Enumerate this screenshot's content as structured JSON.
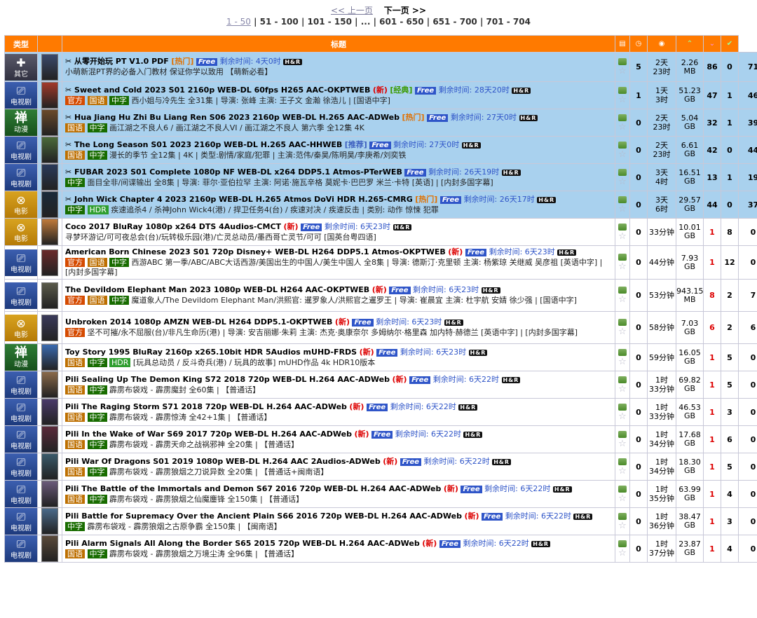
{
  "pager": {
    "prev": "<< 上一页",
    "next": "下一页 >>",
    "pages": [
      "1 - 50",
      "51 - 100",
      "101 - 150",
      "...",
      "601 - 650",
      "651 - 700",
      "701 - 704"
    ]
  },
  "header": {
    "category": "类型",
    "title": "标题",
    "comments_icon": "comments-icon",
    "time_icon": "clock-icon",
    "size_icon": "size-icon",
    "seeders_icon": "seeders-icon",
    "leechers_icon": "leechers-icon",
    "completed_icon": "completed-icon"
  },
  "rows": [
    {
      "cat": "其它",
      "catIcon": "other",
      "top": true,
      "title": "从零开始玩 PT V1.0 PDF",
      "badge": "hot",
      "badge_text": "[热门]",
      "free": "Free",
      "remain": "剩余时间: 4天0时",
      "tags": [],
      "sub": "小萌新混PT界的必备入门教材 保证你学以致用 【萌新必看】",
      "comments": "5",
      "t1": "2天",
      "t2": "23时",
      "s1": "2.26",
      "s2": "MB",
      "seed": "86",
      "leech": "0",
      "done": "71"
    },
    {
      "cat": "电视剧",
      "catIcon": "tv",
      "top": true,
      "title": "Sweet and Cold 2023 S01 2160p WEB-DL 60fps H265 AAC-OKPTWEB",
      "badge": "new",
      "badge_text": "(新)",
      "badge2": "[经典]",
      "free": "Free",
      "remain": "剩余时间: 28天20时",
      "tags": [
        "官方",
        "国语",
        "中字"
      ],
      "sub": "西小姐与冷先生 全31集 | 导演: 张峰 主演: 王子文 金瀚 徐浩儿 | [国语中字]",
      "comments": "1",
      "t1": "1天",
      "t2": "3时",
      "s1": "51.23",
      "s2": "GB",
      "seed": "47",
      "leech": "1",
      "done": "46"
    },
    {
      "cat": "动漫",
      "catIcon": "anime",
      "top": true,
      "title": "Hua Jiang Hu Zhi Bu Liang Ren S06 2023 2160p WEB-DL H.265 AAC-ADWeb",
      "badge": "hot",
      "badge_text": "[热门]",
      "free": "Free",
      "remain": "剩余时间: 27天0时",
      "tags": [
        "国语",
        "中字"
      ],
      "sub": "画江湖之不良人6 / 画江湖之不良人VI / 画江湖之不良人 第六季 全12集 4K",
      "comments": "0",
      "t1": "2天",
      "t2": "23时",
      "s1": "5.04",
      "s2": "GB",
      "seed": "32",
      "leech": "1",
      "done": "39"
    },
    {
      "cat": "电视剧",
      "catIcon": "tv",
      "top": true,
      "title": "The Long Season S01 2023 2160p WEB-DL H.265 AAC-HHWEB",
      "badge": "rec",
      "badge_text": "[推荐]",
      "free": "Free",
      "remain": "剩余时间: 27天0时",
      "tags": [
        "国语",
        "中字"
      ],
      "sub": "漫长的季节 全12集 | 4K | 类型:剧情/家庭/犯罪 | 主演:范伟/秦昊/陈明昊/李庚希/刘奕铁",
      "comments": "0",
      "t1": "2天",
      "t2": "23时",
      "s1": "6.61",
      "s2": "GB",
      "seed": "42",
      "leech": "0",
      "done": "44"
    },
    {
      "cat": "电视剧",
      "catIcon": "tv",
      "top": true,
      "title": "FUBAR 2023 S01 Complete 1080p NF WEB-DL x264 DDP5.1 Atmos-PTerWEB",
      "badge": "",
      "badge_text": "",
      "free": "Free",
      "remain": "剩余时间: 26天19时",
      "tags": [
        "中字"
      ],
      "sub": "面目全非/间谍输出 全8集 | 导演: 菲尔·亚伯拉罕 主演: 阿诺·施瓦辛格 莫妮卡·巴巴罗 米兰·卡特 [英语] | [内封多国字幕]",
      "comments": "0",
      "t1": "3天",
      "t2": "4时",
      "s1": "16.51",
      "s2": "GB",
      "seed": "13",
      "leech": "1",
      "done": "19"
    },
    {
      "cat": "电影",
      "catIcon": "movie",
      "top": true,
      "title": "John Wick Chapter 4 2023 2160p WEB-DL H.265 Atmos DoVi HDR H.265-CMRG",
      "badge": "hot",
      "badge_text": "[热门]",
      "free": "Free",
      "remain": "剩余时间: 26天17时",
      "tags": [
        "中字",
        "HDR"
      ],
      "sub": "疾速追杀4 / 杀神John Wick4(港) / 捍卫任务4(台) / 疾速对决 / 疾速反击 | 类别: 动作 惊悚 犯罪",
      "comments": "0",
      "t1": "3天",
      "t2": "6时",
      "s1": "29.57",
      "s2": "GB",
      "seed": "44",
      "leech": "0",
      "done": "37"
    },
    {
      "cat": "电影",
      "catIcon": "movie",
      "top": false,
      "title": "Coco 2017 BluRay 1080p x264 DTS 4Audios-CMCT",
      "badge": "new",
      "badge_text": "(新)",
      "free": "Free",
      "remain": "剩余时间: 6天23时",
      "tags": [],
      "sub": "寻梦环游记/可可夜总会(台)/玩转极乐园(港)/亡灵总动员/墨西哥亡灵节/可可 [国英台粤四语]",
      "comments": "0",
      "t1": "33分钟",
      "t2": "",
      "s1": "10.01",
      "s2": "GB",
      "seed": "1",
      "leech": "8",
      "done": "0"
    },
    {
      "cat": "电视剧",
      "catIcon": "tv",
      "top": false,
      "title": "American Born Chinese 2023 S01 720p Disney+ WEB-DL H264 DDP5.1 Atmos-OKPTWEB",
      "badge": "new",
      "badge_text": "(新)",
      "free": "Free",
      "remain": "剩余时间: 6天23时",
      "tags": [
        "官方",
        "国语",
        "中字"
      ],
      "sub": "西游ABC 第一季/ABC/ABC大话西游/美国出生的中国人/美生中国人 全8集 | 导演: 德斯汀·克里顿 主演: 杨紫琼 关继威 吴彦祖 [英语中字] | [内封多国字幕]",
      "comments": "0",
      "t1": "44分钟",
      "t2": "",
      "s1": "7.93",
      "s2": "GB",
      "seed": "1",
      "leech": "12",
      "done": "0"
    },
    {
      "cat": "电视剧",
      "catIcon": "tv",
      "top": false,
      "title": "The Devildom Elephant Man 2023 1080p WEB-DL H264 AAC-OKPTWEB",
      "badge": "new",
      "badge_text": "(新)",
      "free": "Free",
      "remain": "剩余时间: 6天23时",
      "tags": [
        "官方",
        "国语",
        "中字"
      ],
      "sub": "魔道象人/The Devildom Elephant Man/洪熙官: 暹罗象人/洪熙官之暹罗王 | 导演: 崔晨宜 主演: 杜宇航 安婧 徐少强 | [国语中字]",
      "comments": "0",
      "t1": "53分钟",
      "t2": "",
      "s1": "943.15",
      "s2": "MB",
      "seed": "8",
      "leech": "2",
      "done": "7"
    },
    {
      "cat": "电影",
      "catIcon": "movie",
      "top": false,
      "title": "Unbroken 2014 1080p AMZN WEB-DL H264 DDP5.1-OKPTWEB",
      "badge": "new",
      "badge_text": "(新)",
      "free": "Free",
      "remain": "剩余时间: 6天23时",
      "tags": [
        "官方"
      ],
      "sub": "坚不可摧/永不屈服(台)/非凡生命历(港) | 导演: 安吉丽娜·朱莉 主演: 杰克·奥康奈尔 多姆纳尔·格里森 加内特·赫德兰 [英语中字] | [内封多国字幕]",
      "comments": "0",
      "t1": "58分钟",
      "t2": "",
      "s1": "7.03",
      "s2": "GB",
      "seed": "6",
      "leech": "2",
      "done": "6"
    },
    {
      "cat": "动漫",
      "catIcon": "anime",
      "top": false,
      "title": "Toy Story 1995 BluRay 2160p x265.10bit HDR 5Audios mUHD-FRDS",
      "badge": "new",
      "badge_text": "(新)",
      "free": "Free",
      "remain": "剩余时间: 6天23时",
      "tags": [
        "国语",
        "中字",
        "HDR"
      ],
      "sub": "[玩具总动员 / 反斗奇兵(港) / 玩具的故事] mUHD作品 4k HDR10版本",
      "comments": "0",
      "t1": "59分钟",
      "t2": "",
      "s1": "16.05",
      "s2": "GB",
      "seed": "1",
      "leech": "5",
      "done": "0"
    },
    {
      "cat": "电视剧",
      "catIcon": "tv",
      "top": false,
      "title": "Pili Sealing Up The Demon King S72 2018 720p WEB-DL H.264 AAC-ADWeb",
      "badge": "new",
      "badge_text": "(新)",
      "free": "Free",
      "remain": "剩余时间: 6天22时",
      "tags": [
        "国语",
        "中字"
      ],
      "sub": "霹雳布袋戏 - 霹雳魔封 全60集 | 【普通话】",
      "comments": "0",
      "t1": "1时",
      "t2": "33分钟",
      "s1": "69.82",
      "s2": "GB",
      "seed": "1",
      "leech": "5",
      "done": "0"
    },
    {
      "cat": "电视剧",
      "catIcon": "tv",
      "top": false,
      "title": "Pili The Raging Storm S71 2018 720p WEB-DL H.264 AAC-ADWeb",
      "badge": "new",
      "badge_text": "(新)",
      "free": "Free",
      "remain": "剩余时间: 6天22时",
      "tags": [
        "国语",
        "中字"
      ],
      "sub": "霹雳布袋戏 - 霹雳惊涛 全42+1集 | 【普通话】",
      "comments": "0",
      "t1": "1时",
      "t2": "33分钟",
      "s1": "46.53",
      "s2": "GB",
      "seed": "1",
      "leech": "3",
      "done": "0"
    },
    {
      "cat": "电视剧",
      "catIcon": "tv",
      "top": false,
      "title": "Pili In the Wake of War S69 2017 720p WEB-DL H.264 AAC-ADWeb",
      "badge": "new",
      "badge_text": "(新)",
      "free": "Free",
      "remain": "剩余时间: 6天22时",
      "tags": [
        "国语",
        "中字"
      ],
      "sub": "霹雳布袋戏 - 霹雳天命之战祸邪神 全20集 | 【普通话】",
      "comments": "0",
      "t1": "1时",
      "t2": "34分钟",
      "s1": "17.68",
      "s2": "GB",
      "seed": "1",
      "leech": "6",
      "done": "0"
    },
    {
      "cat": "电视剧",
      "catIcon": "tv",
      "top": false,
      "title": "Pili War Of Dragons S01 2019 1080p WEB-DL H.264 AAC 2Audios-ADWeb",
      "badge": "new",
      "badge_text": "(新)",
      "free": "Free",
      "remain": "剩余时间: 6天22时",
      "tags": [
        "国语",
        "中字"
      ],
      "sub": "霹雳布袋戏 - 霹雳狼烟之刀说异数 全20集 | 【普通话+闽南语】",
      "comments": "0",
      "t1": "1时",
      "t2": "34分钟",
      "s1": "18.30",
      "s2": "GB",
      "seed": "1",
      "leech": "5",
      "done": "0"
    },
    {
      "cat": "电视剧",
      "catIcon": "tv",
      "top": false,
      "title": "Pili The Battle of the Immortals and Demon S67 2016 720p WEB-DL H.264 AAC-ADWeb",
      "badge": "new",
      "badge_text": "(新)",
      "free": "Free",
      "remain": "剩余时间: 6天22时",
      "tags": [
        "国语",
        "中字"
      ],
      "sub": "霹雳布袋戏 - 霹雳狼烟之仙魔鏖锋 全150集 | 【普通话】",
      "comments": "0",
      "t1": "1时",
      "t2": "35分钟",
      "s1": "63.99",
      "s2": "GB",
      "seed": "1",
      "leech": "4",
      "done": "0"
    },
    {
      "cat": "电视剧",
      "catIcon": "tv",
      "top": false,
      "title": "Pili Battle for Supremacy Over the Ancient Plain S66 2016 720p WEB-DL H.264 AAC-ADWeb",
      "badge": "new",
      "badge_text": "(新)",
      "free": "Free",
      "remain": "剩余时间: 6天22时",
      "tags": [
        "中字"
      ],
      "sub": "霹雳布袋戏 - 霹雳狼烟之古原争霸 全150集 | 【闽南语】",
      "comments": "0",
      "t1": "1时",
      "t2": "36分钟",
      "s1": "38.47",
      "s2": "GB",
      "seed": "1",
      "leech": "3",
      "done": "0"
    },
    {
      "cat": "电视剧",
      "catIcon": "tv",
      "top": false,
      "title": "Pili Alarm Signals All Along the Border S65 2015 720p WEB-DL H.264 AAC-ADWeb",
      "badge": "new",
      "badge_text": "(新)",
      "free": "Free",
      "remain": "剩余时间: 6天22时",
      "tags": [
        "国语",
        "中字"
      ],
      "sub": "霹雳布袋戏 - 霹雳狼烟之万境尘涛 全96集 | 【普通话】",
      "comments": "0",
      "t1": "1时",
      "t2": "37分钟",
      "s1": "23.87",
      "s2": "GB",
      "seed": "1",
      "leech": "4",
      "done": "0"
    }
  ],
  "colors": {
    "header": "#ff7a00",
    "top_row": "#a9d1ee",
    "free": "#2f55c8",
    "new": "#dd0000",
    "hot": "#e07000"
  },
  "hr_badge": "H&R"
}
